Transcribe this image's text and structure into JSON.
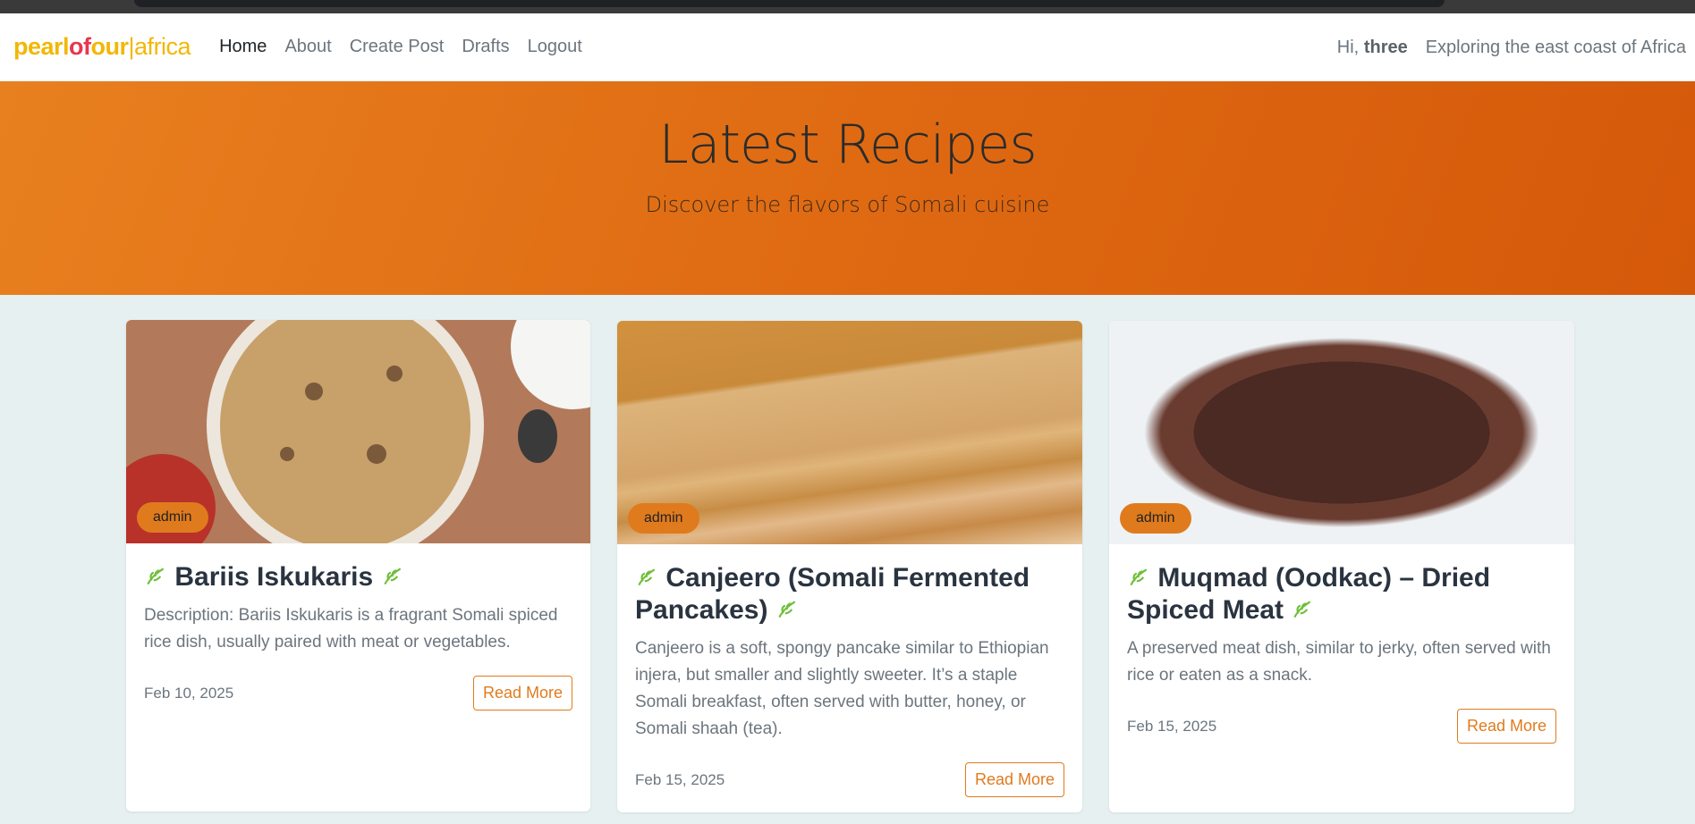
{
  "brand": {
    "p1": "pearl",
    "p2": "of",
    "p3": "our",
    "p4": "|africa"
  },
  "nav": {
    "items": [
      {
        "label": "Home",
        "active": true
      },
      {
        "label": "About"
      },
      {
        "label": "Create Post"
      },
      {
        "label": "Drafts"
      },
      {
        "label": "Logout"
      }
    ],
    "greeting_prefix": "Hi,",
    "username": "three",
    "tagline": "Exploring the east coast of Africa"
  },
  "hero": {
    "title": "Latest Recipes",
    "subtitle": "Discover the flavors of Somali cuisine"
  },
  "cards": [
    {
      "badge": "admin",
      "title": "Bariis Iskukaris",
      "description": "Description: Bariis Iskukaris is a fragrant Somali spiced rice dish, usually paired with meat or vegetables.",
      "date": "Feb 10, 2025",
      "button": "Read More"
    },
    {
      "badge": "admin",
      "title": "Canjeero (Somali Fermented Pancakes)",
      "description": "Canjeero is a soft, spongy pancake similar to Ethiopian injera, but smaller and slightly sweeter. It’s a staple Somali breakfast, often served with butter, honey, or Somali shaah (tea).",
      "date": "Feb 15, 2025",
      "button": "Read More"
    },
    {
      "badge": "admin",
      "title": "Muqmad (Oodkac) – Dried Spiced Meat",
      "description": "A preserved meat dish, similar to jerky, often served with rice or eaten as a snack.",
      "date": "Feb 15, 2025",
      "button": "Read More"
    }
  ],
  "colors": {
    "accent": "#e07b1d",
    "hero": "#df6a12",
    "page_bg": "#e6f0f0"
  }
}
